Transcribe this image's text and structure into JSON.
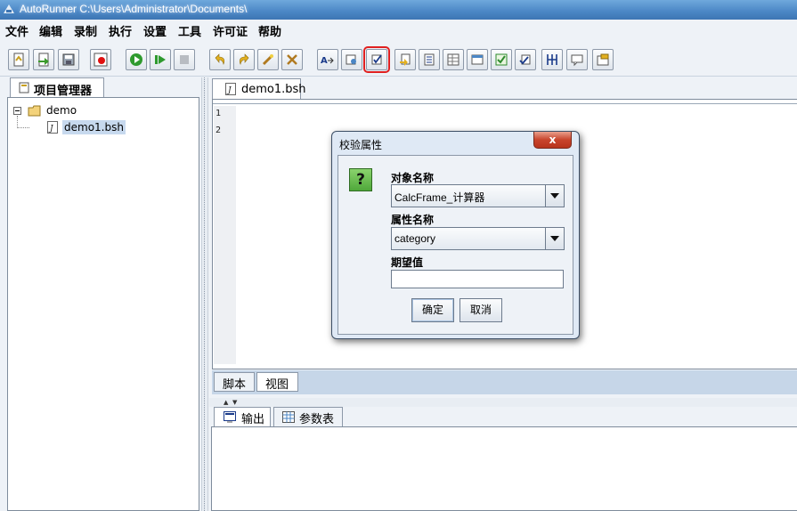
{
  "window": {
    "title": "AutoRunner  C:\\Users\\Administrator\\Documents\\"
  },
  "menu": [
    "文件",
    "编辑",
    "录制",
    "执行",
    "设置",
    "工具",
    "许可证",
    "帮助"
  ],
  "toolbar": {
    "buttons": [
      "new-script",
      "open",
      "save",
      "record",
      "run",
      "run-step",
      "stop",
      "undo",
      "redo",
      "check-object",
      "check-region",
      "text-check",
      "add-checkpoint",
      "check-property",
      "check-1",
      "check-2",
      "check-3",
      "check-4",
      "check-5",
      "check-6",
      "align",
      "comment",
      "properties"
    ],
    "highlighted": "check-property"
  },
  "project_panel": {
    "tab_label": "项目管理器",
    "tree": {
      "root": "demo",
      "children": [
        "demo1.bsh"
      ],
      "selected": "demo1.bsh"
    }
  },
  "editor": {
    "tab_label": "demo1.bsh",
    "line_numbers": [
      "1",
      "2"
    ],
    "bottom_tabs": [
      "脚本",
      "视图"
    ]
  },
  "output": {
    "tabs": [
      "输出",
      "参数表"
    ]
  },
  "dialog": {
    "title": "校验属性",
    "close_label": "x",
    "object_label": "对象名称",
    "object_value": "CalcFrame_计算器",
    "property_label": "属性名称",
    "property_value": "category",
    "expected_label": "期望值",
    "expected_value": "",
    "ok_label": "确定",
    "cancel_label": "取消",
    "icon_glyph": "?"
  }
}
